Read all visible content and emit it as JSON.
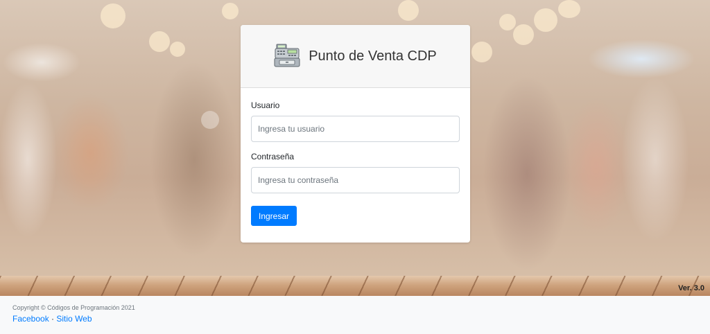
{
  "app": {
    "title": "Punto de Venta CDP",
    "version": "Ver. 3.0"
  },
  "login": {
    "username_label": "Usuario",
    "username_placeholder": "Ingresa tu usuario",
    "password_label": "Contraseña",
    "password_placeholder": "Ingresa tu contraseña",
    "submit_label": "Ingresar"
  },
  "footer": {
    "copyright": "Copyright © Códigos de Programación 2021",
    "link_facebook": "Facebook",
    "separator": "·",
    "link_website": "Sitio Web"
  },
  "icons": {
    "brand": "cash-register-icon"
  },
  "colors": {
    "primary": "#007bff",
    "footer_bg": "#f8f9fa",
    "card_header_bg": "#f7f7f7"
  }
}
